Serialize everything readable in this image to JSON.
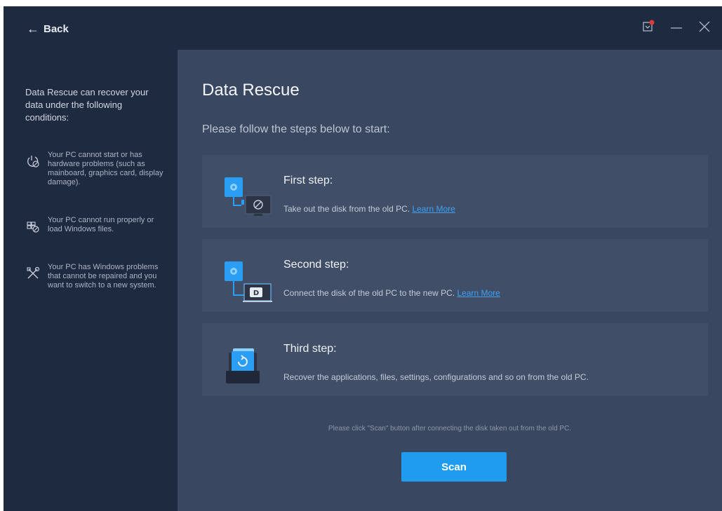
{
  "header": {
    "back_label": "Back"
  },
  "sidebar": {
    "intro": "Data Rescue can recover your data under the following conditions:",
    "conditions": [
      {
        "text": "Your PC cannot start or has hardware problems (such as mainboard, graphics card, display damage).",
        "icon": "power-damage-icon"
      },
      {
        "text": "Your PC cannot run properly or load Windows files.",
        "icon": "windows-error-icon"
      },
      {
        "text": "Your PC has Windows problems that cannot be repaired and you want to switch to a new system.",
        "icon": "tools-icon"
      }
    ]
  },
  "main": {
    "title": "Data Rescue",
    "subtitle": "Please follow the steps below to start:",
    "steps": [
      {
        "title": "First step:",
        "desc": "Take out the disk from the old PC.",
        "link": "Learn More"
      },
      {
        "title": "Second step:",
        "desc": "Connect the disk of the old PC to the new PC.",
        "link": "Learn More"
      },
      {
        "title": "Third step:",
        "desc": "Recover the applications, files, settings, configurations and so on from the old PC."
      }
    ],
    "hint": "Please click \"Scan\" button after connecting the disk taken out from the old PC.",
    "scan_label": "Scan"
  },
  "colors": {
    "accent": "#1f9bf0",
    "link": "#3fa0f5",
    "sidebar": "#1e2a40",
    "content": "#3a4761"
  }
}
